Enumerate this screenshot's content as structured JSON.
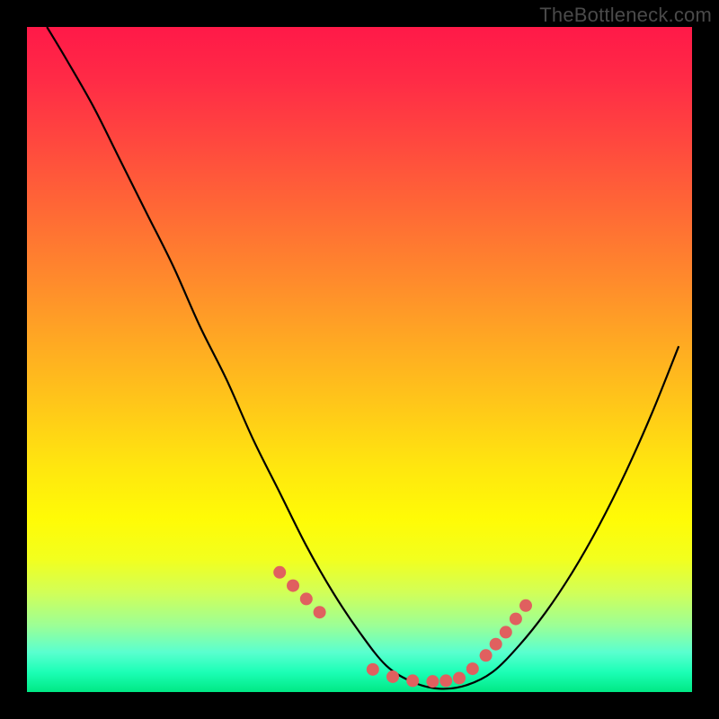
{
  "watermark": "TheBottleneck.com",
  "chart_data": {
    "type": "line",
    "title": "",
    "xlabel": "",
    "ylabel": "",
    "xlim": [
      0,
      100
    ],
    "ylim": [
      0,
      100
    ],
    "grid": false,
    "legend": false,
    "series": [
      {
        "name": "bottleneck-curve",
        "color": "#000000",
        "x": [
          3,
          6,
          10,
          14,
          18,
          22,
          26,
          30,
          34,
          38,
          42,
          46,
          50,
          54,
          58,
          62,
          66,
          70,
          74,
          78,
          82,
          86,
          90,
          94,
          98
        ],
        "y": [
          100,
          95,
          88,
          80,
          72,
          64,
          55,
          47,
          38,
          30,
          22,
          15,
          9,
          4,
          1.5,
          0.5,
          1,
          3,
          7,
          12,
          18,
          25,
          33,
          42,
          52
        ]
      }
    ],
    "markers": {
      "name": "highlight-points",
      "color": "#e0605f",
      "radius": 7,
      "x": [
        38,
        40,
        42,
        44,
        52,
        55,
        58,
        61,
        63,
        65,
        67,
        69,
        70.5,
        72,
        73.5,
        75
      ],
      "y": [
        18,
        16,
        14,
        12,
        3.4,
        2.3,
        1.7,
        1.6,
        1.7,
        2.1,
        3.5,
        5.5,
        7.2,
        9,
        11,
        13
      ]
    },
    "background_gradient": {
      "top": "#ff1948",
      "bottom": "#00e884"
    }
  }
}
